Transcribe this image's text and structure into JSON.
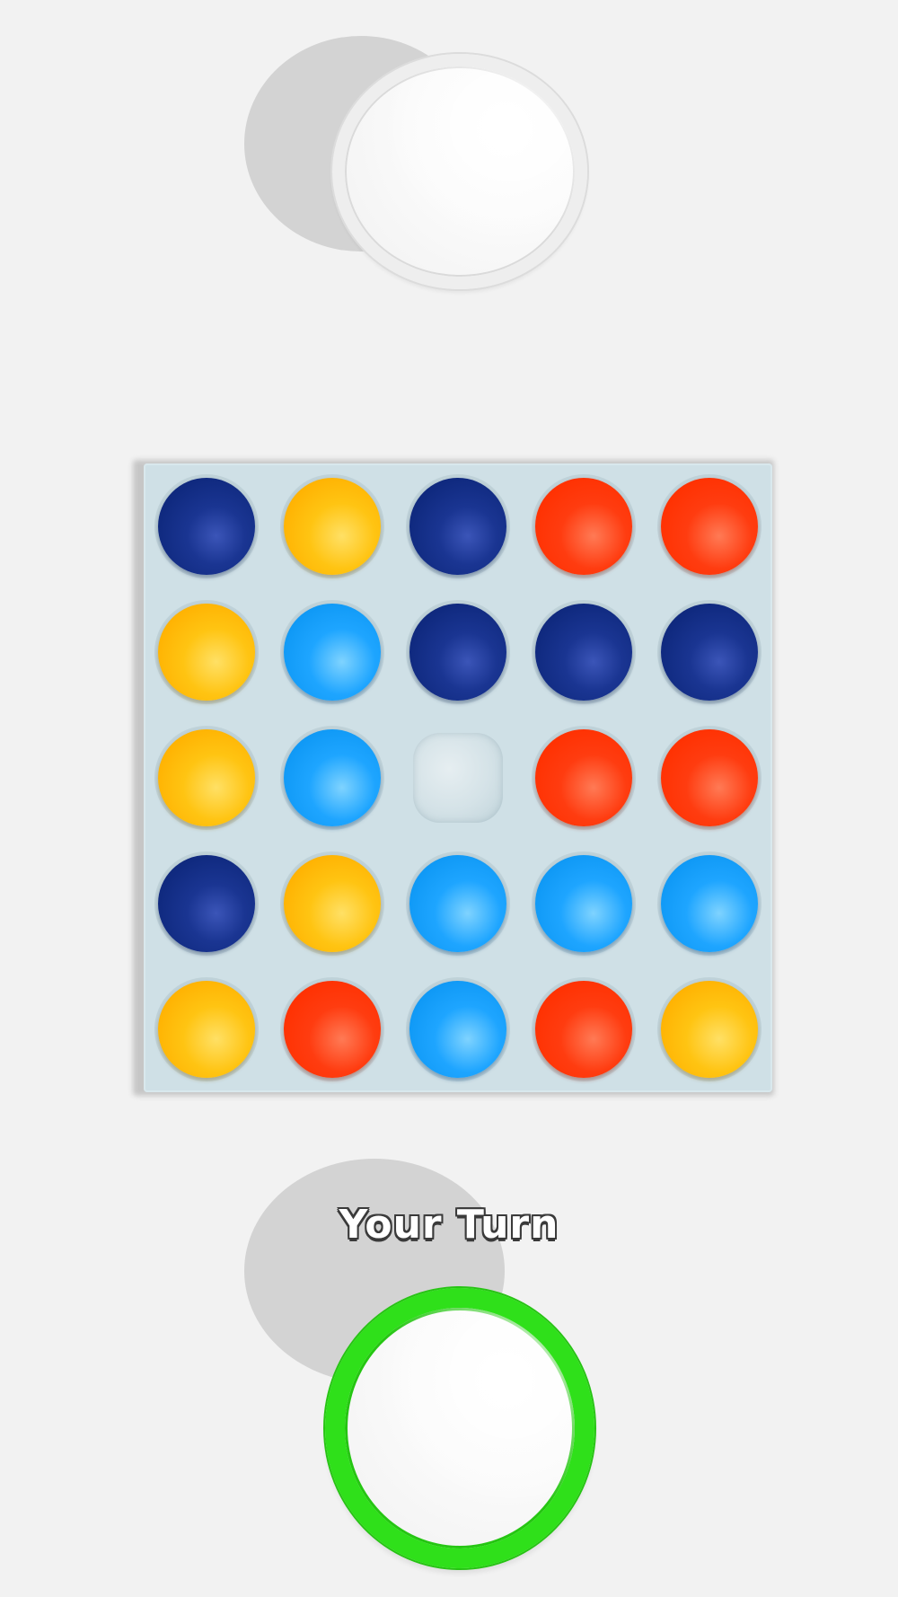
{
  "opponent": {
    "cup_icon": "white-cup-icon"
  },
  "player": {
    "status_text": "Your Turn",
    "cup_icon": "green-cup-icon",
    "ring_color": "#2fe01a"
  },
  "board": {
    "rows": 5,
    "cols": 5,
    "colors": {
      "navy": "#12297f",
      "yellow": "#ffc000",
      "red": "#ff3200",
      "cyan": "#1aa0ff"
    },
    "cells": [
      [
        "navy",
        "yellow",
        "navy",
        "red",
        "red"
      ],
      [
        "yellow",
        "cyan",
        "navy",
        "navy",
        "navy"
      ],
      [
        "yellow",
        "cyan",
        "empty",
        "red",
        "red"
      ],
      [
        "navy",
        "yellow",
        "cyan",
        "cyan",
        "cyan"
      ],
      [
        "yellow",
        "red",
        "cyan",
        "red",
        "yellow"
      ]
    ]
  }
}
